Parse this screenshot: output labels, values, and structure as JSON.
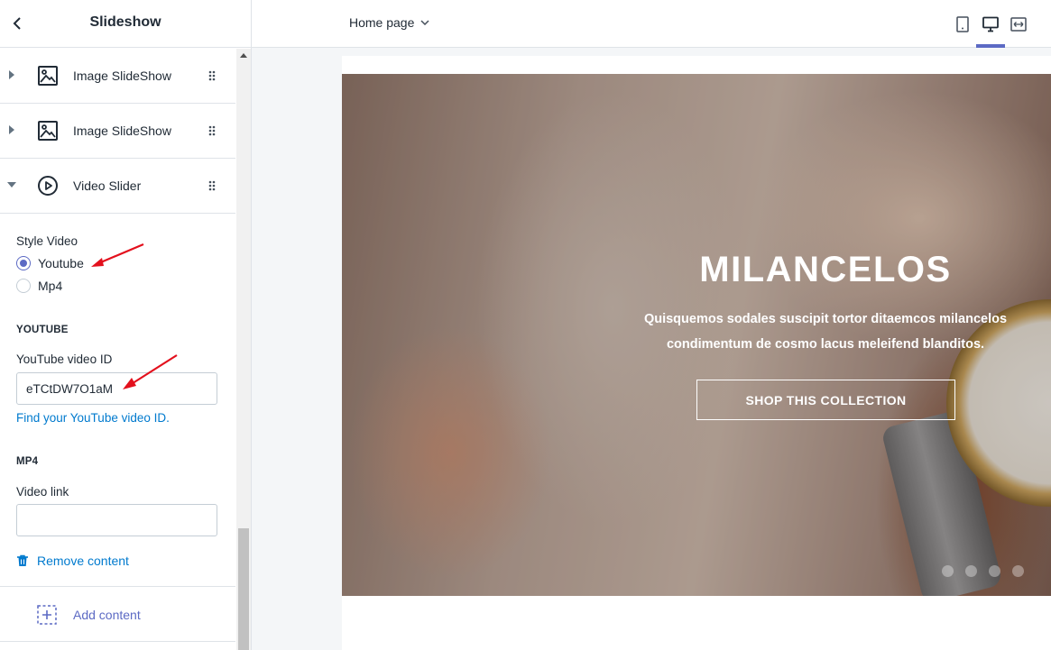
{
  "sidebar": {
    "title": "Slideshow",
    "sections": [
      {
        "label": "Image SlideShow",
        "expanded": false,
        "icon": "image-icon"
      },
      {
        "label": "Image SlideShow",
        "expanded": false,
        "icon": "image-icon"
      },
      {
        "label": "Video Slider",
        "expanded": true,
        "icon": "play-circle-icon"
      }
    ],
    "style_video": {
      "label": "Style Video",
      "options": [
        {
          "label": "Youtube",
          "checked": true
        },
        {
          "label": "Mp4",
          "checked": false
        }
      ]
    },
    "youtube": {
      "heading": "YOUTUBE",
      "field_label": "YouTube video ID",
      "value": "eTCtDW7O1aM",
      "help_link": "Find your YouTube video ID."
    },
    "mp4": {
      "heading": "MP4",
      "field_label": "Video link",
      "value": ""
    },
    "remove_label": "Remove content",
    "add_label": "Add content"
  },
  "topbar": {
    "page_select": "Home page",
    "devices": [
      "mobile-icon",
      "desktop-icon",
      "fullwidth-icon"
    ],
    "active_device": "desktop-icon"
  },
  "preview": {
    "title": "MILANCELOS",
    "subtitle_line1": "Quisquemos sodales suscipit tortor ditaemcos milancelos",
    "subtitle_line2": "condimentum de cosmo lacus meleifend blanditos.",
    "cta": "SHOP THIS COLLECTION",
    "slide_dots": 4
  },
  "colors": {
    "accent": "#5c6ac4",
    "link": "#007ace",
    "annotation": "#e3101d",
    "border": "#dfe3e8"
  }
}
